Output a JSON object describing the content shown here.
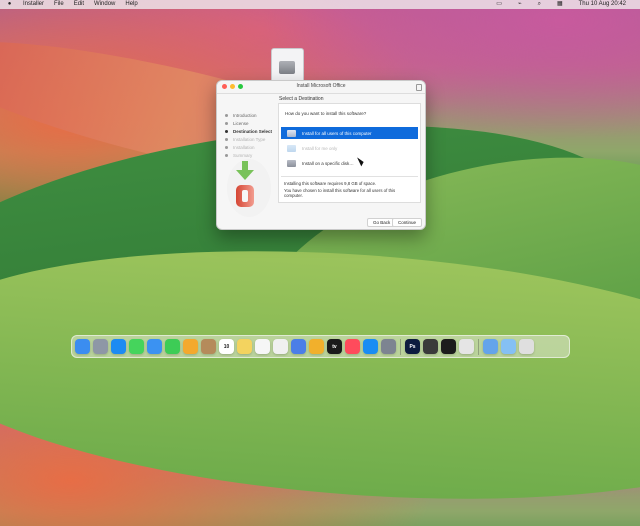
{
  "menubar": {
    "apple": "",
    "items": [
      "Installer",
      "File",
      "Edit",
      "Window",
      "Help"
    ],
    "date_time": "Thu 10 Aug  20:42"
  },
  "installer": {
    "title": "Install Microsoft Office",
    "heading": "Select a Destination",
    "steps": [
      {
        "label": "Introduction",
        "state": "done"
      },
      {
        "label": "License",
        "state": "done"
      },
      {
        "label": "Destination Select",
        "state": "active"
      },
      {
        "label": "Installation Type",
        "state": "disabled"
      },
      {
        "label": "Installation",
        "state": "disabled"
      },
      {
        "label": "Summary",
        "state": "disabled"
      }
    ],
    "question": "How do you want to install this software?",
    "options": [
      {
        "label": "Install for all users of this computer",
        "state": "selected"
      },
      {
        "label": "Install for me only",
        "state": "disabled"
      },
      {
        "label": "Install on a specific disk…",
        "state": "normal"
      }
    ],
    "space": "Installing this software requires 9,8 GB of space.",
    "message": "You have chosen to install this software for all users of this computer.",
    "buttons": {
      "back": "Go Back",
      "continue": "Continue"
    }
  },
  "dock": {
    "apps": [
      {
        "name": "finder-icon",
        "label": "",
        "color": "#3b8df0"
      },
      {
        "name": "launchpad-icon",
        "label": "",
        "color": "#8e97a6"
      },
      {
        "name": "safari-icon",
        "label": "",
        "color": "#1d8bf2"
      },
      {
        "name": "messages-icon",
        "label": "",
        "color": "#45d45c"
      },
      {
        "name": "mail-icon",
        "label": "",
        "color": "#3b92f2"
      },
      {
        "name": "facetime-icon",
        "label": "",
        "color": "#3dcc56"
      },
      {
        "name": "photos-icon",
        "label": "",
        "color": "#f4a92d"
      },
      {
        "name": "contacts-icon",
        "label": "",
        "color": "#b58b5b"
      },
      {
        "name": "calendar-icon",
        "label": "10",
        "color": "#ffffff"
      },
      {
        "name": "notes-icon",
        "label": "",
        "color": "#f3d35f"
      },
      {
        "name": "reminders-icon",
        "label": "",
        "color": "#f6f6f6"
      },
      {
        "name": "notes-list-icon",
        "label": "",
        "color": "#f0f0f0"
      },
      {
        "name": "preview-icon",
        "label": "",
        "color": "#4b7ee7"
      },
      {
        "name": "chrome-icon",
        "label": "",
        "color": "#f1b02c"
      },
      {
        "name": "appletv-icon",
        "label": "tv",
        "color": "#1a1a1a"
      },
      {
        "name": "music-icon",
        "label": "",
        "color": "#ff4b5c"
      },
      {
        "name": "appstore-icon",
        "label": "",
        "color": "#1a8df3"
      },
      {
        "name": "settings-icon",
        "label": "",
        "color": "#7d8491"
      },
      {
        "name": "photoshop-icon",
        "label": "Ps",
        "color": "#0d1c3f"
      },
      {
        "name": "activity-icon",
        "label": "",
        "color": "#3a3a3a"
      },
      {
        "name": "terminal-icon",
        "label": "",
        "color": "#1c1c1c"
      },
      {
        "name": "installer-icon",
        "label": "",
        "color": "#e5e5e5"
      },
      {
        "name": "downloads-icon",
        "label": "",
        "color": "#64a4eb"
      },
      {
        "name": "folder-icon",
        "label": "",
        "color": "#85c0f4"
      },
      {
        "name": "trash-icon",
        "label": "",
        "color": "#dfdfdf"
      }
    ]
  }
}
